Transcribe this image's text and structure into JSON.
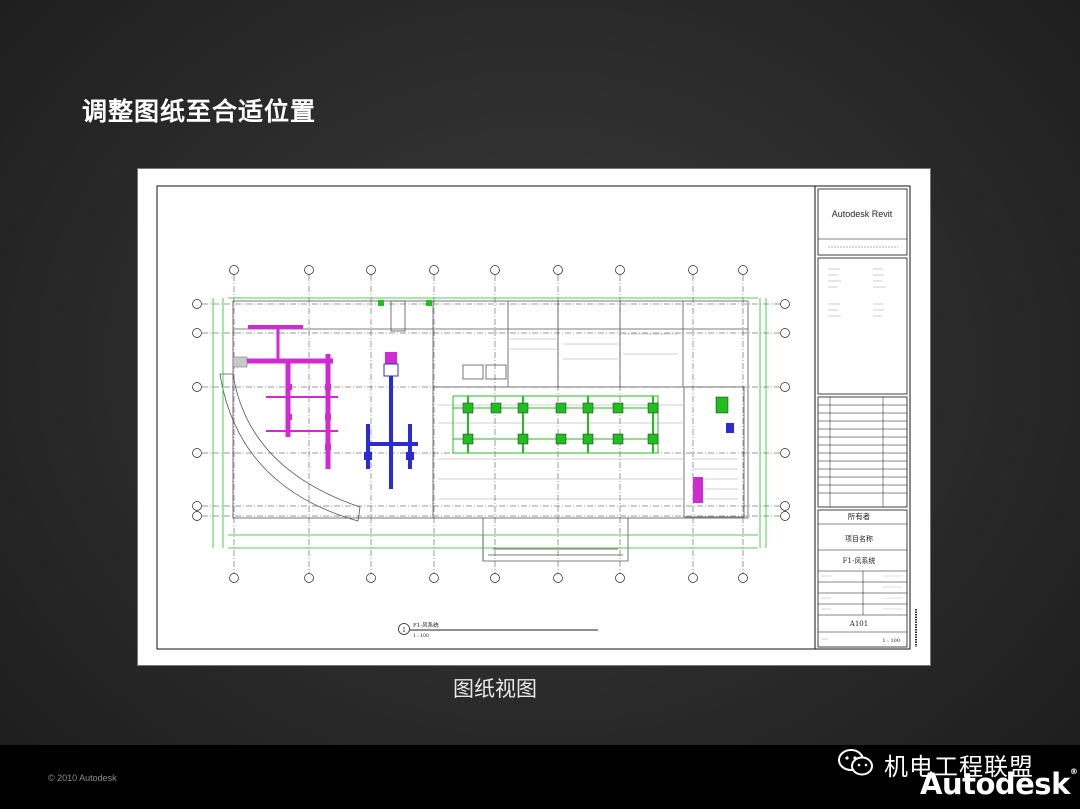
{
  "slide": {
    "title": "调整图纸至合适位置",
    "caption": "图纸视图"
  },
  "sheet": {
    "titleblock": {
      "brand": "Autodesk Revit",
      "owner": "所有者",
      "project_name": "项目名称",
      "sheet_name": "F1-风系统",
      "sheet_number": "A101",
      "scale": "1 : 100"
    },
    "view_label": {
      "number": "1",
      "name": "F1-风系统",
      "scale": "1 : 100"
    }
  },
  "footer": {
    "copyright": "© 2010 Autodesk",
    "account_name": "机电工程联盟",
    "brand": "Autodesk"
  },
  "colors": {
    "duct_magenta": "#d22ad2",
    "duct_blue": "#2b2bd6",
    "duct_green": "#1fbf1f",
    "grid_line": "#000000"
  }
}
